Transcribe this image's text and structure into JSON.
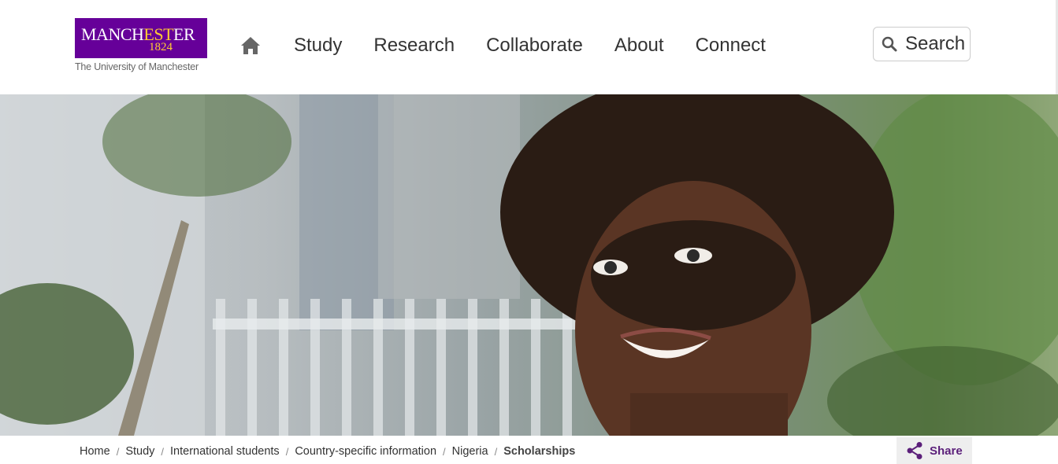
{
  "logo": {
    "word_part1": "MANCH",
    "word_part2": "EST",
    "word_part3": "ER",
    "year": "1824",
    "subtitle": "The University of Manchester",
    "brand_color": "#660099",
    "accent_color": "#ffcc33"
  },
  "nav": {
    "home_icon": "home-icon",
    "items": [
      {
        "label": "Study"
      },
      {
        "label": "Research"
      },
      {
        "label": "Collaborate"
      },
      {
        "label": "About"
      },
      {
        "label": "Connect"
      }
    ]
  },
  "search": {
    "label": "Search",
    "icon": "search-icon"
  },
  "hero": {
    "image": "smiling-student-photo"
  },
  "breadcrumb": {
    "items": [
      {
        "label": "Home"
      },
      {
        "label": "Study"
      },
      {
        "label": "International students"
      },
      {
        "label": "Country-specific information"
      },
      {
        "label": "Nigeria"
      }
    ],
    "current": "Scholarships",
    "separator": "/"
  },
  "share": {
    "label": "Share",
    "icon": "share-icon",
    "color": "#5b1f7a"
  }
}
